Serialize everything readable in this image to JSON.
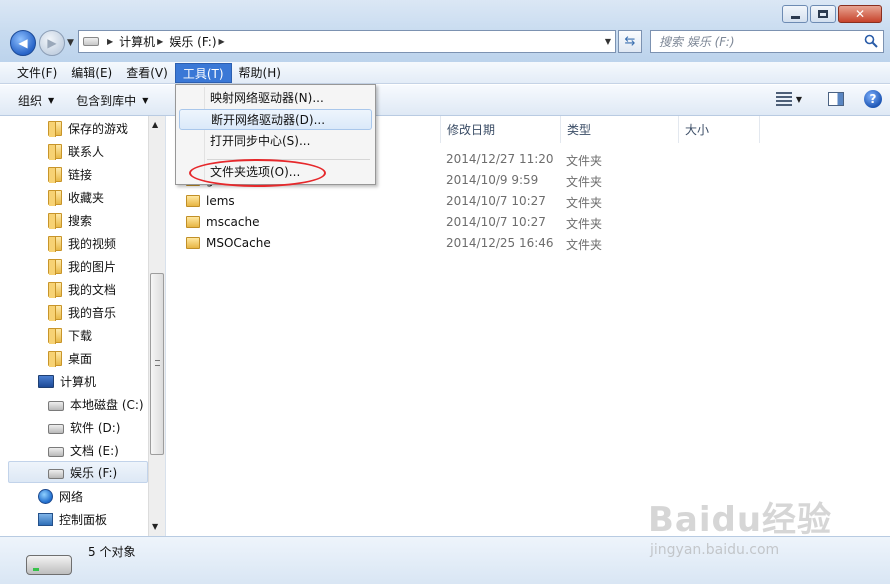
{
  "address": {
    "crumbs": [
      "计算机",
      "娱乐 (F:)"
    ]
  },
  "search": {
    "placeholder": "搜索 娱乐 (F:)"
  },
  "menubar": [
    "文件(F)",
    "编辑(E)",
    "查看(V)",
    "工具(T)",
    "帮助(H)"
  ],
  "toolbar": {
    "organize": "组织",
    "include": "包含到库中"
  },
  "tools_menu": {
    "items": [
      "映射网络驱动器(N)...",
      "断开网络驱动器(D)...",
      "打开同步中心(S)...",
      "文件夹选项(O)..."
    ]
  },
  "nav": {
    "items": [
      "保存的游戏",
      "联系人",
      "链接",
      "收藏夹",
      "搜索",
      "我的视频",
      "我的图片",
      "我的文档",
      "我的音乐",
      "下载",
      "桌面",
      "计算机",
      "本地磁盘 (C:)",
      "软件 (D:)",
      "文档 (E:)",
      "娱乐 (F:)",
      "网络",
      "控制面板"
    ]
  },
  "columns": {
    "date": "修改日期",
    "type": "类型",
    "size": "大小"
  },
  "files": [
    {
      "name": "",
      "date": "2014/12/27 11:20",
      "type": "文件夹"
    },
    {
      "name": "g",
      "date": "2014/10/9 9:59",
      "type": "文件夹"
    },
    {
      "name": "lems",
      "date": "2014/10/7 10:27",
      "type": "文件夹"
    },
    {
      "name": "mscache",
      "date": "2014/10/7 10:27",
      "type": "文件夹"
    },
    {
      "name": "MSOCache",
      "date": "2014/12/25 16:46",
      "type": "文件夹"
    }
  ],
  "status": {
    "text": "5 个对象"
  },
  "watermark": {
    "logo": "Baidu经验",
    "sub": "jingyan.baidu.com"
  },
  "colors": {
    "highlight": "#3a78d6",
    "annotation": "#e6282b"
  }
}
